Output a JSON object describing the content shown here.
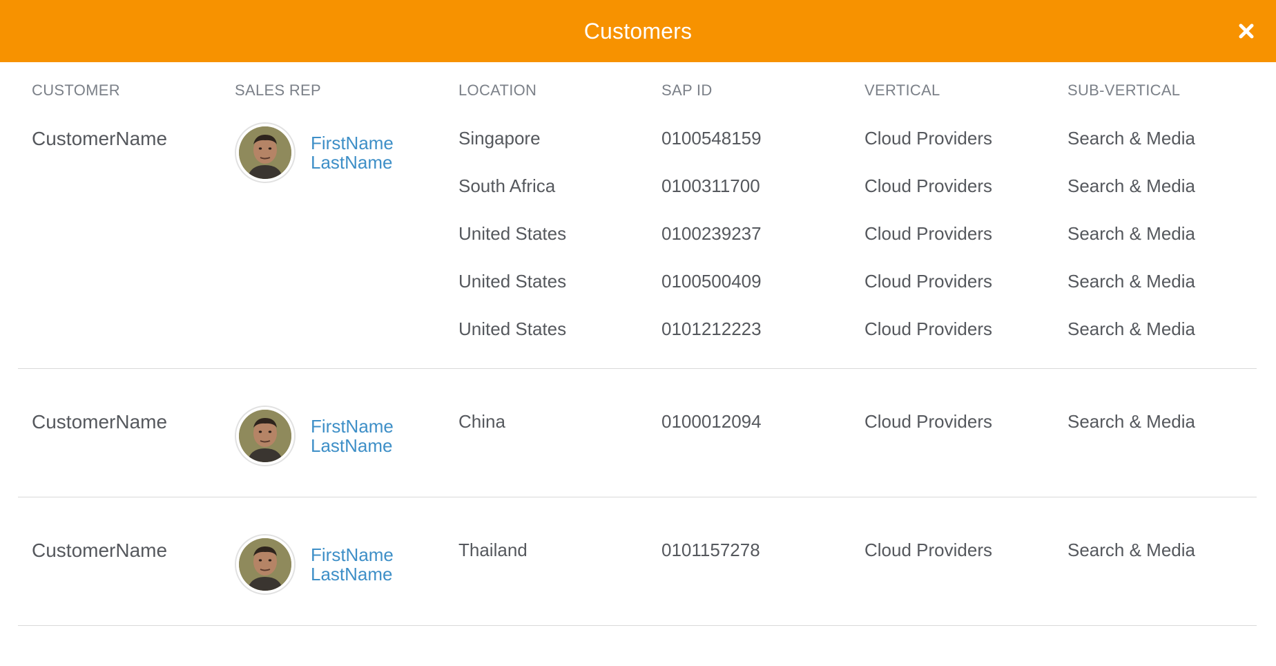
{
  "modal": {
    "title": "Customers",
    "close_icon": "close-icon"
  },
  "columns": {
    "customer": "CUSTOMER",
    "sales_rep": "SALES REP",
    "location": "LOCATION",
    "sap_id": "SAP ID",
    "vertical": "VERTICAL",
    "sub_vertical": "SUB-VERTICAL"
  },
  "customers": [
    {
      "name": "CustomerName",
      "rep_first": "FirstName",
      "rep_last": "LastName",
      "rows": [
        {
          "location": "Singapore",
          "sap_id": "0100548159",
          "vertical": "Cloud Providers",
          "sub_vertical": "Search & Media"
        },
        {
          "location": "South Africa",
          "sap_id": "0100311700",
          "vertical": "Cloud Providers",
          "sub_vertical": "Search & Media"
        },
        {
          "location": "United States",
          "sap_id": "0100239237",
          "vertical": "Cloud Providers",
          "sub_vertical": "Search & Media"
        },
        {
          "location": "United States",
          "sap_id": "0100500409",
          "vertical": "Cloud Providers",
          "sub_vertical": "Search & Media"
        },
        {
          "location": "United States",
          "sap_id": "0101212223",
          "vertical": "Cloud Providers",
          "sub_vertical": "Search & Media"
        }
      ]
    },
    {
      "name": "CustomerName",
      "rep_first": "FirstName",
      "rep_last": "LastName",
      "rows": [
        {
          "location": "China",
          "sap_id": "0100012094",
          "vertical": "Cloud Providers",
          "sub_vertical": "Search & Media"
        }
      ]
    },
    {
      "name": "CustomerName",
      "rep_first": "FirstName",
      "rep_last": "LastName",
      "rows": [
        {
          "location": "Thailand",
          "sap_id": "0101157278",
          "vertical": "Cloud Providers",
          "sub_vertical": "Search & Media"
        }
      ]
    }
  ],
  "colors": {
    "header_bg": "#f79200",
    "link": "#3e8fc7",
    "text": "#55585d",
    "header_text": "#7b8088"
  }
}
